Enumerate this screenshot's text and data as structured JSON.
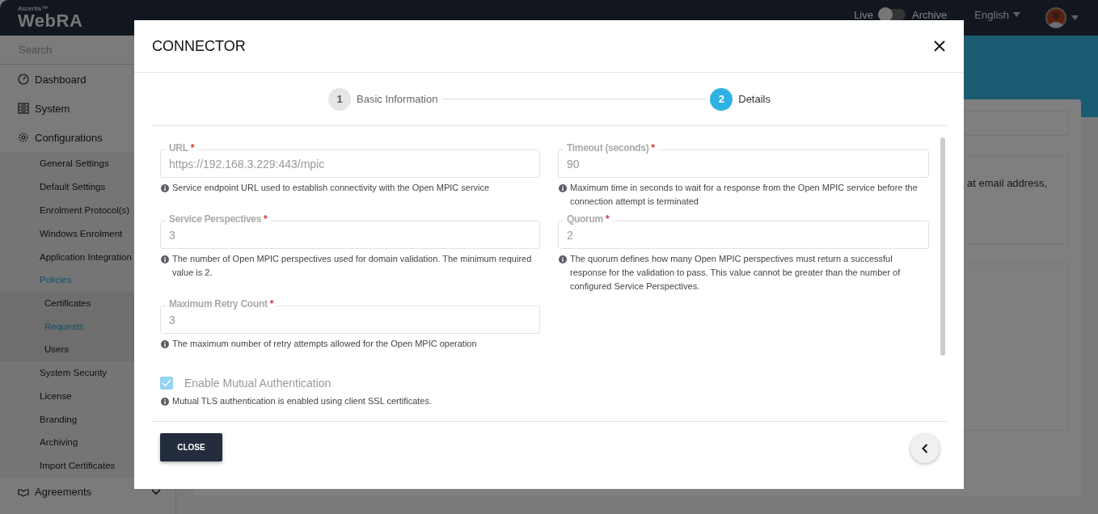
{
  "header": {
    "brand_small": "Ascertia™",
    "brand": "WebRA",
    "live_label": "Live",
    "live_on": false,
    "archive_label": "Archive",
    "language": "English"
  },
  "sidebar": {
    "search_placeholder": "Search",
    "items": [
      {
        "label": "Dashboard",
        "selected": false
      },
      {
        "label": "System",
        "selected": false
      },
      {
        "label": "Configurations",
        "selected": false,
        "children": [
          {
            "label": "General Settings",
            "selected": false
          },
          {
            "label": "Default Settings",
            "selected": false
          },
          {
            "label": "Enrolment Protocol(s)",
            "selected": false
          },
          {
            "label": "Windows Enrolment",
            "selected": false
          },
          {
            "label": "Application Integration",
            "selected": false
          },
          {
            "label": "Policies",
            "selected": true,
            "children": [
              {
                "label": "Certificates",
                "selected": false
              },
              {
                "label": "Requests",
                "selected": true
              },
              {
                "label": "Users",
                "selected": false
              }
            ]
          },
          {
            "label": "System Security",
            "selected": false
          },
          {
            "label": "License",
            "selected": false
          },
          {
            "label": "Branding",
            "selected": false
          },
          {
            "label": "Archiving",
            "selected": false
          },
          {
            "label": "Import Certificates",
            "selected": false
          }
        ]
      },
      {
        "label": "Agreements",
        "selected": false,
        "expanded": false
      }
    ]
  },
  "background_text": "at email address,",
  "modal": {
    "title": "CONNECTOR",
    "steps": [
      {
        "number": "1",
        "label": "Basic Information",
        "selected": false
      },
      {
        "number": "2",
        "label": "Details",
        "selected": true
      }
    ],
    "fields": [
      {
        "label": "URL",
        "required_mark": "*",
        "disabled": true,
        "value": "https://192.168.3.229:443/mpic",
        "hint": "Service endpoint URL used to establish connectivity with the Open MPIC service"
      },
      {
        "label": "Timeout (seconds)",
        "required_mark": "*",
        "disabled": true,
        "value": "90",
        "hint": "Maximum time in seconds to wait for a response from the Open MPIC service before the connection attempt is terminated"
      },
      {
        "label": "Service Perspectives",
        "required_mark": "*",
        "disabled": true,
        "value": "3",
        "hint": "The number of Open MPIC perspectives used for domain validation. The minimum required value is 2."
      },
      {
        "label": "Quorum",
        "required_mark": "*",
        "disabled": true,
        "value": "2",
        "hint": "The quorum defines how many Open MPIC perspectives must return a successful response for the validation to pass. This value cannot be greater than the number of configured Service Perspectives."
      },
      {
        "label": "Maximum Retry Count",
        "required_mark": "*",
        "disabled": true,
        "value": "3",
        "hint": "The maximum number of retry attempts allowed for the Open MPIC operation"
      }
    ],
    "checkbox": {
      "label": "Enable Mutual Authentication",
      "checked": true,
      "disabled": true,
      "hint": "Mutual TLS authentication is enabled using client SSL certificates."
    },
    "close_button": "CLOSE"
  }
}
